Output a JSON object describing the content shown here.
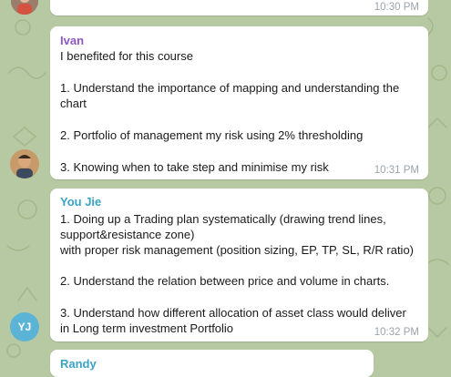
{
  "messages": [
    {
      "time": "10:30 PM",
      "avatar_icon": "user-photo-avatar-icon"
    },
    {
      "sender": "Ivan",
      "sender_color": "#8e58c7",
      "lines": [
        "I benefited for this course",
        "1. Understand the importance of mapping and understanding the",
        "chart",
        "2. Portfolio of management my risk using 2% thresholding",
        "3. Knowing when to take step and minimise my risk"
      ],
      "time": "10:31 PM",
      "avatar_icon": "user-photo-avatar-icon"
    },
    {
      "sender": "You Jie",
      "sender_color": "#3aa3c4",
      "lines": [
        "1. Doing up a Trading plan systematically (drawing trend lines,",
        "support&resistance zone)",
        "with proper risk management (position sizing, EP, TP, SL, R/R ratio)",
        "2. Understand the relation between price and volume in charts.",
        "3. Understand how different allocation of asset class would deliver",
        "in Long term investment Portfolio"
      ],
      "time": "10:32 PM",
      "avatar_initials": "YJ",
      "avatar_color": "#5bb4d6"
    },
    {
      "sender": "Randy",
      "sender_color": "#3aa3c4"
    }
  ]
}
